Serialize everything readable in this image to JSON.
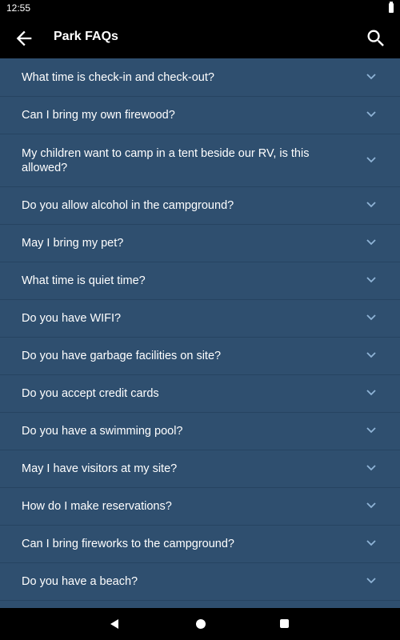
{
  "status_bar": {
    "time": "12:55"
  },
  "app_bar": {
    "title": "Park FAQs",
    "back_icon": "arrow-left-icon",
    "search_icon": "search-icon"
  },
  "colors": {
    "list_background": "#2f4f6f",
    "divider": "#264461",
    "chevron": "#8fb3d6",
    "bars": "#000000"
  },
  "faqs": [
    "What time is check-in and check-out?",
    "Can I bring my own firewood?",
    "My children want to camp in a tent beside our RV, is this allowed?",
    "Do you allow alcohol in the campground?",
    "May I bring my pet?",
    "What time is quiet time?",
    "Do you have WIFI?",
    "Do you have garbage facilities on site?",
    "Do you accept credit cards",
    "Do you have a swimming pool?",
    "May I have visitors at my site?",
    "How do I make reservations?",
    "Can I bring fireworks to the campground?",
    "Do you have a beach?"
  ],
  "nav_bar": {
    "back_icon": "triangle-back-icon",
    "home_icon": "circle-home-icon",
    "recents_icon": "square-recents-icon"
  }
}
